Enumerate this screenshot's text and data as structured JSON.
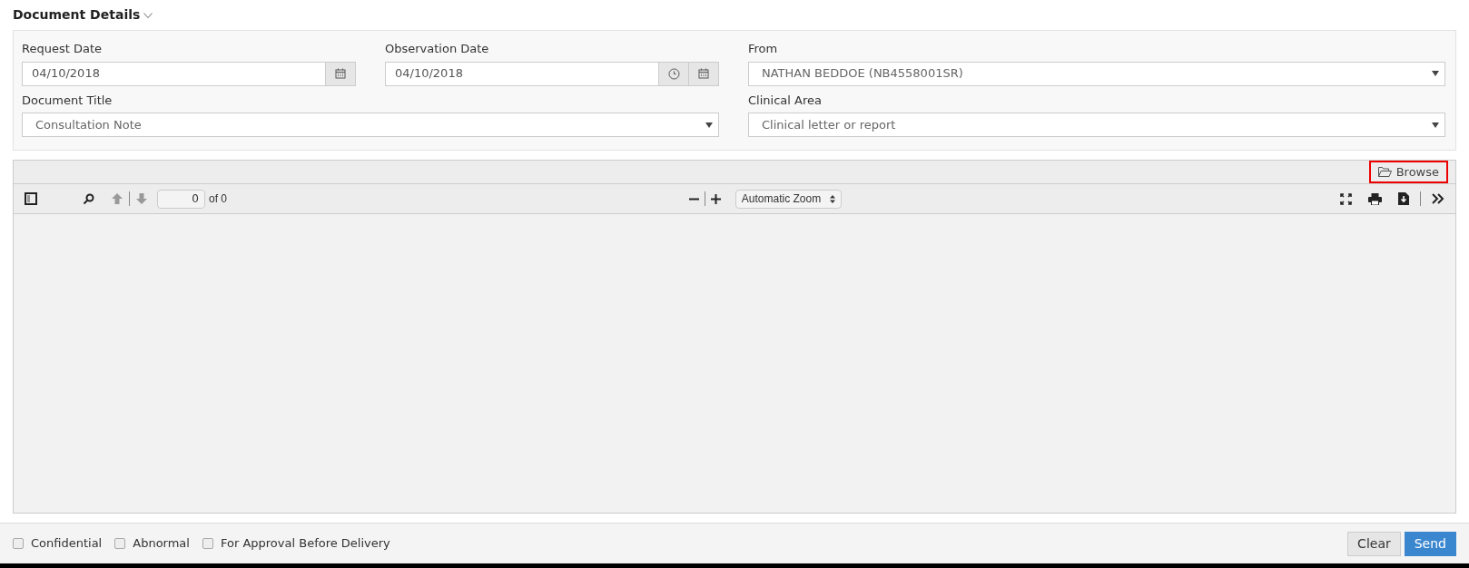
{
  "section": {
    "title": "Document Details",
    "expanded": true
  },
  "fields": [
    {
      "label": "Request Date",
      "kind": "date",
      "value": "04/10/2018"
    },
    {
      "label": "Observation Date",
      "kind": "datetime",
      "value": "04/10/2018"
    },
    {
      "label": "From",
      "kind": "select",
      "value": "NATHAN BEDDOE (NB4558001SR)"
    },
    {
      "label": "Document Title",
      "kind": "select",
      "value": "Consultation Note"
    },
    {
      "label": "Clinical Area",
      "kind": "select",
      "value": "Clinical letter or report"
    }
  ],
  "viewer": {
    "browse": "Browse",
    "page": "0",
    "page_count": "of 0",
    "zoom": "Automatic Zoom"
  },
  "options": [
    {
      "label": "Confidential",
      "checked": false
    },
    {
      "label": "Abnormal",
      "checked": false
    },
    {
      "label": "For Approval Before Delivery",
      "checked": false
    }
  ],
  "buttons": [
    {
      "label": "Clear",
      "kind": "secondary"
    },
    {
      "label": "Send",
      "kind": "primary"
    }
  ]
}
